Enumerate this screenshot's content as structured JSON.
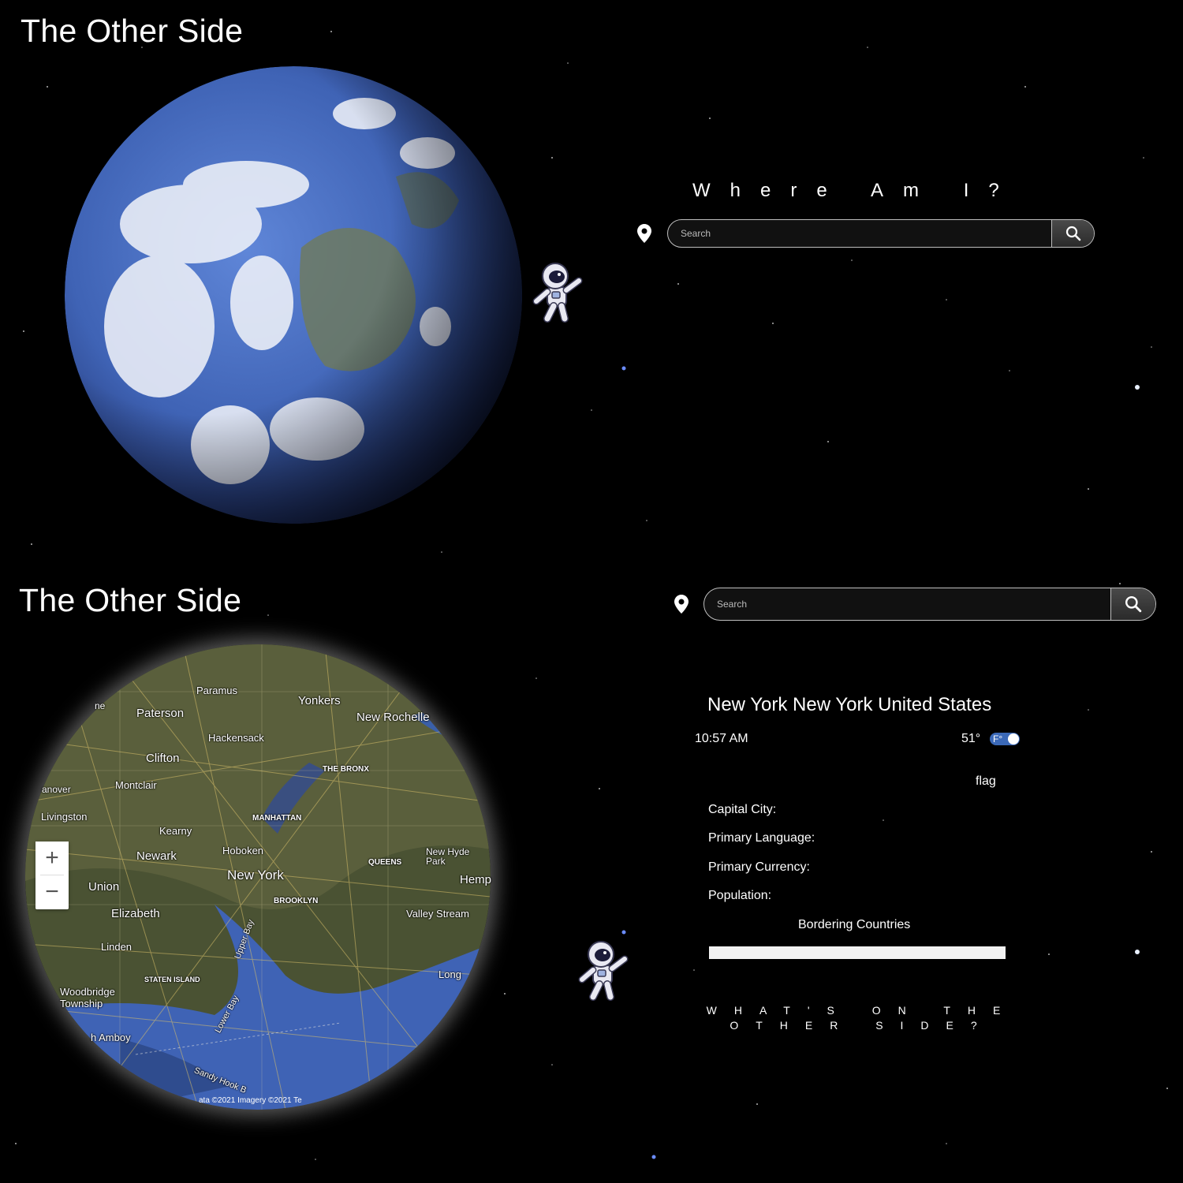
{
  "top": {
    "title": "The Other Side",
    "heading": "Where Am I?",
    "search": {
      "placeholder": "Search"
    }
  },
  "bottom": {
    "title": "The Other Side",
    "search": {
      "placeholder": "Search"
    },
    "map": {
      "labels": [
        "Paramus",
        "Paterson",
        "Yonkers",
        "New Rochelle",
        "Hackensack",
        "Clifton",
        "Montclair",
        "Livingston",
        "Kearny",
        "MANHATTAN",
        "THE BRONX",
        "Hoboken",
        "Newark",
        "New York",
        "QUEENS",
        "New Hyde Park",
        "Hemp",
        "Union",
        "Elizabeth",
        "BROOKLYN",
        "Valley Stream",
        "Linden",
        "Upper Bay",
        "STATEN ISLAND",
        "Long",
        "Woodbridge Township",
        "h Amboy",
        "Lower Bay",
        "Sandy Hook B",
        "anover",
        "ne"
      ],
      "zoom_in": "+",
      "zoom_out": "−",
      "attribution": "ata ©2021 Imagery ©2021 Te"
    },
    "info": {
      "location": "New York New York United States",
      "time": "10:57 AM",
      "temperature": "51°",
      "unit": "F°",
      "flag": "flag",
      "capital_label": "Capital City:",
      "language_label": "Primary Language:",
      "currency_label": "Primary Currency:",
      "population_label": "Population:",
      "bordering_label": "Bordering Countries"
    },
    "tagline": "WHAT'S ON THE OTHER SIDE?"
  },
  "colors": {
    "background": "#000000",
    "toggle": "#3b69b8",
    "ocean": "#3f63b5"
  }
}
